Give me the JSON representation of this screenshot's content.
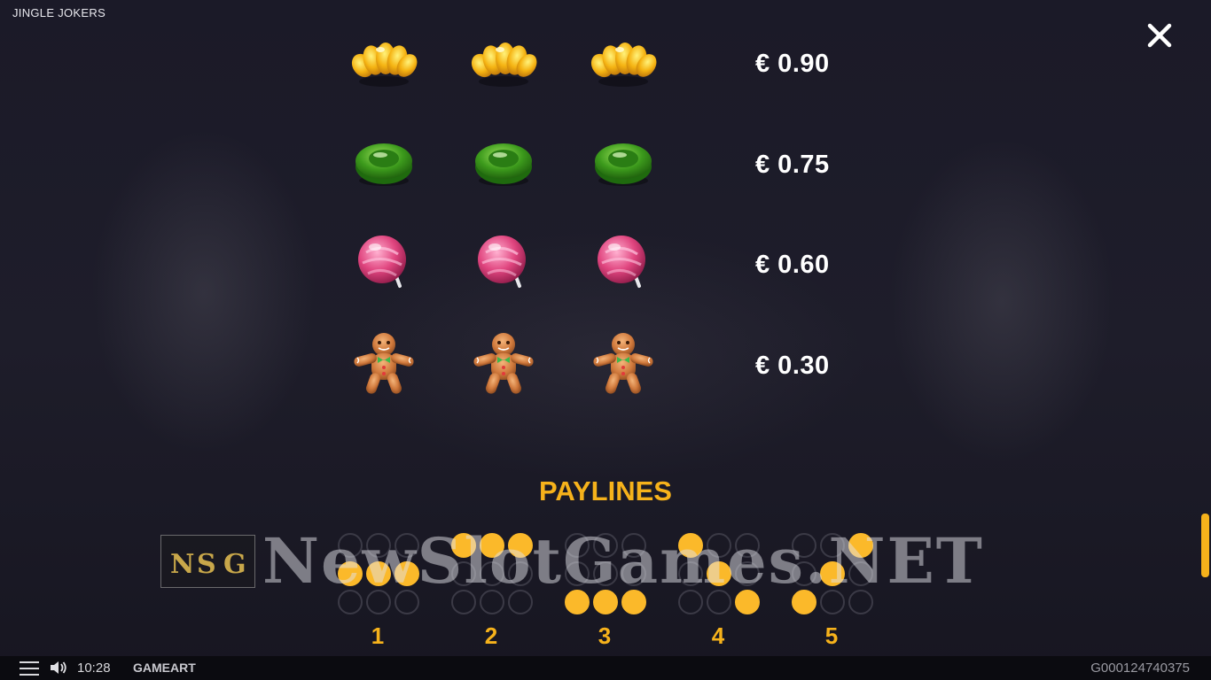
{
  "header": {
    "game_title": "JINGLE JOKERS"
  },
  "paytable": [
    {
      "symbol": "orange-candy-icon",
      "payout": "€ 0.90"
    },
    {
      "symbol": "green-candy-icon",
      "payout": "€ 0.75"
    },
    {
      "symbol": "pink-lollipop-icon",
      "payout": "€ 0.60"
    },
    {
      "symbol": "gingerbread-man-icon",
      "payout": "€ 0.30"
    }
  ],
  "paylines": {
    "title": "PAYLINES",
    "lines": [
      {
        "number": "1",
        "rows": [
          1,
          1,
          1
        ]
      },
      {
        "number": "2",
        "rows": [
          0,
          0,
          0
        ]
      },
      {
        "number": "3",
        "rows": [
          2,
          2,
          2
        ]
      },
      {
        "number": "4",
        "rows": [
          0,
          1,
          2
        ]
      },
      {
        "number": "5",
        "rows": [
          2,
          1,
          0
        ]
      }
    ]
  },
  "watermark": {
    "logo_letters": "NSG",
    "text": "NewSlotGames.NET"
  },
  "footer": {
    "time": "10:28",
    "brand": "GAMEART",
    "session_id": "G000124740375"
  },
  "colors": {
    "accent": "#f6b21b",
    "background": "#1b1a28",
    "dot_off": "#3b3a46"
  }
}
